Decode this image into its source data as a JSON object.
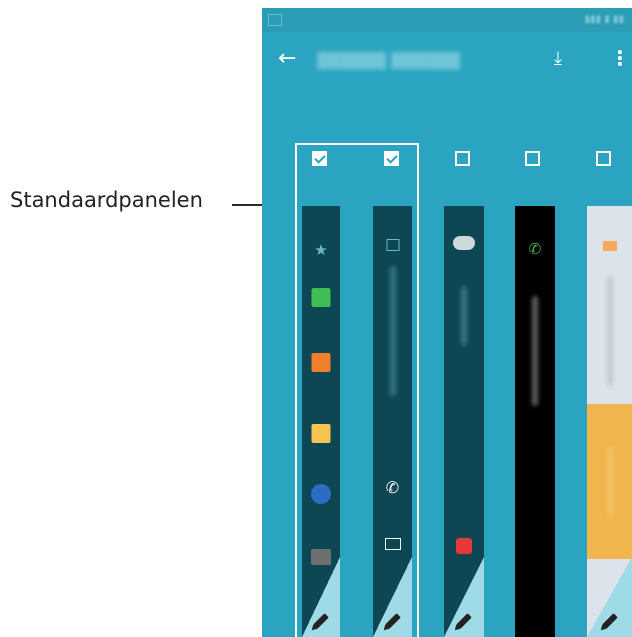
{
  "callout": {
    "label": "Standaardpanelen"
  },
  "header": {
    "back_icon": "arrow-left-icon",
    "download_icon": "download-icon",
    "more_icon": "more-vert-icon"
  },
  "panels": [
    {
      "name": "people-edge",
      "checked": true
    },
    {
      "name": "briefing-feed",
      "checked": true
    },
    {
      "name": "info-panel-1",
      "checked": false
    },
    {
      "name": "info-panel-2",
      "checked": false
    },
    {
      "name": "info-panel-3",
      "checked": false
    }
  ],
  "colors": {
    "background": "#2aa4c0",
    "panel_dark": "#0e4754",
    "panel_black": "#000000",
    "panel_light": "#dde3ea",
    "accent_orange": "#f0b54c"
  }
}
